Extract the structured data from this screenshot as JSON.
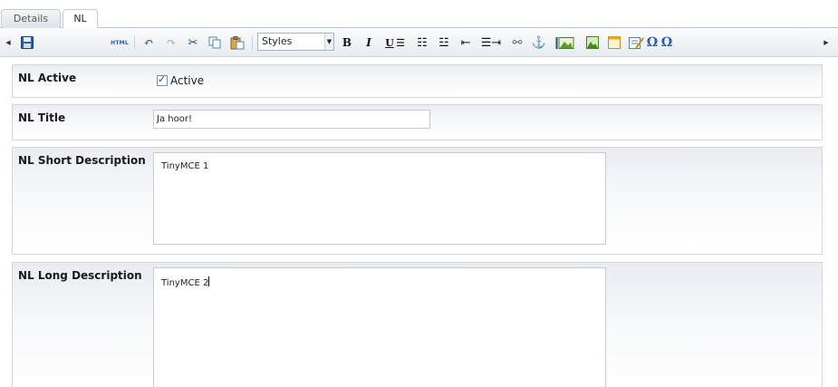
{
  "tabs": [
    {
      "label": "Details",
      "active": false
    },
    {
      "label": "NL",
      "active": true
    }
  ],
  "toolbar": {
    "scroll_left_icon": "triangle-left-icon",
    "scroll_right_icon": "triangle-right-icon",
    "save_icon": "floppy-disk-icon",
    "html_label": "HTML",
    "styles_value": "Styles",
    "bold_glyph": "B",
    "italic_glyph": "I",
    "underline_glyph": "U",
    "omega_glyph": "Ω",
    "accent_color": "#1c4f94"
  },
  "fields": {
    "active": {
      "label": "NL Active",
      "checkbox_label": "Active",
      "checked": true
    },
    "title": {
      "label": "NL Title",
      "value": "Ja hoor!"
    },
    "short_description": {
      "label": "NL Short Description",
      "content": "TinyMCE 1"
    },
    "long_description": {
      "label": "NL Long Description",
      "content": "TinyMCE 2"
    }
  }
}
